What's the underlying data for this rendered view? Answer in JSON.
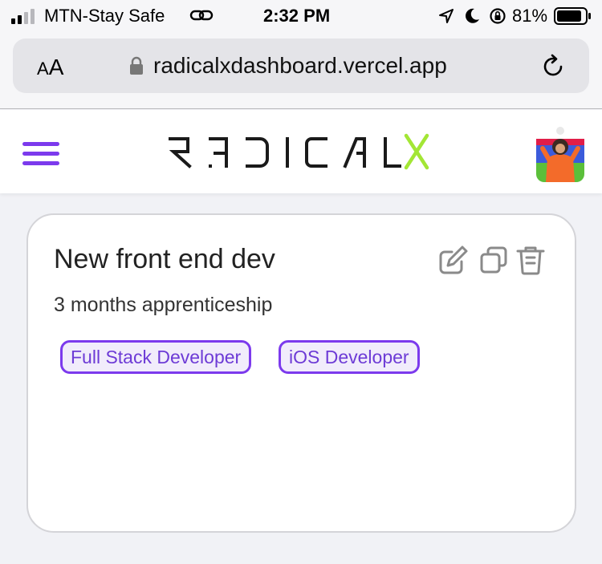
{
  "status_bar": {
    "carrier": "MTN-Stay Safe",
    "time": "2:32 PM",
    "battery_percent": "81%",
    "icons": [
      "signal-icon",
      "link-icon",
      "location-icon",
      "moon-icon",
      "rotation-lock-icon",
      "battery-icon"
    ]
  },
  "browser": {
    "text_size_label_big": "A",
    "text_size_label_small": "A",
    "url": "radicalxdashboard.vercel.app",
    "icons": [
      "lock-icon",
      "reload-icon"
    ]
  },
  "header": {
    "logo_text": "RADICALX",
    "accent_color": "#7c3aed",
    "logo_accent_color": "#a3e635",
    "icons": [
      "menu-icon",
      "avatar"
    ]
  },
  "card": {
    "title": "New front end dev",
    "subtitle": "3 months apprenticeship",
    "tags": [
      "Full Stack Developer",
      "iOS Developer"
    ],
    "icons": [
      "edit-icon",
      "copy-icon",
      "trash-icon"
    ]
  }
}
